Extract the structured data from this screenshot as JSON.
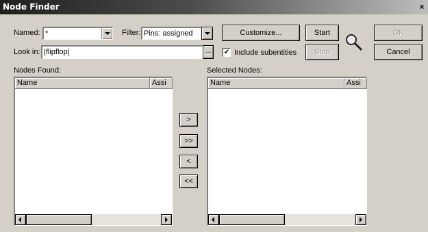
{
  "window": {
    "title": "Node Finder",
    "close_glyph": "×"
  },
  "named": {
    "label": "Named:",
    "value": "*"
  },
  "filter": {
    "label": "Filter:",
    "value": "Pins: assigned"
  },
  "look_in": {
    "label": "Look in:",
    "value": "|flipflop|",
    "browse_label": "..."
  },
  "buttons": {
    "customize": "Customize...",
    "start": "Start",
    "stop": "Stop",
    "ok": "OK",
    "cancel": "Cancel"
  },
  "include_subentities": {
    "label": "Include subentities",
    "checked": true,
    "mark": "✔"
  },
  "nodes_found": {
    "label": "Nodes Found:",
    "columns": [
      "Name",
      "Assi"
    ],
    "rows": []
  },
  "selected_nodes": {
    "label": "Selected Nodes:",
    "columns": [
      "Name",
      "Assi"
    ],
    "rows": []
  },
  "transfer_buttons": {
    "add": ">",
    "add_all": ">>",
    "remove": "<",
    "remove_all": "<<"
  },
  "icons": {
    "search": "magnifier-icon"
  }
}
